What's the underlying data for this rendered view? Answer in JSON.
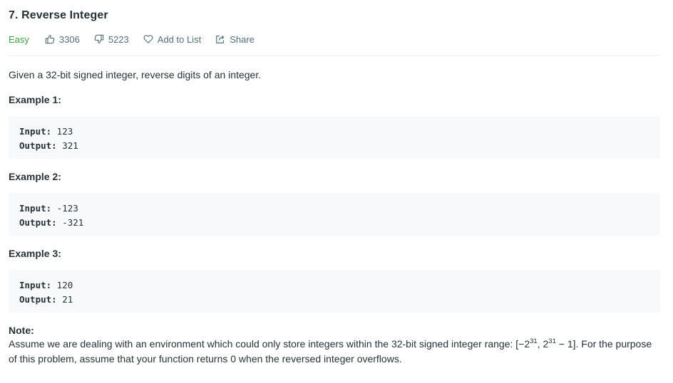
{
  "problem": {
    "title": "7. Reverse Integer",
    "difficulty": "Easy",
    "likes": "3306",
    "dislikes": "5223",
    "add_to_list_label": "Add to List",
    "share_label": "Share"
  },
  "colors": {
    "difficulty_easy": "#43a047",
    "code_bg": "#f7f9fa",
    "divider": "#eceff1"
  },
  "description": {
    "intro": "Given a 32-bit signed integer, reverse digits of an integer."
  },
  "examples": [
    {
      "heading": "Example 1:",
      "input_label": "Input:",
      "input": " 123",
      "output_label": "Output:",
      "output": " 321"
    },
    {
      "heading": "Example 2:",
      "input_label": "Input:",
      "input": " -123",
      "output_label": "Output:",
      "output": " -321"
    },
    {
      "heading": "Example 3:",
      "input_label": "Input:",
      "input": " 120",
      "output_label": "Output:",
      "output": " 21"
    }
  ],
  "note": {
    "heading": "Note:",
    "text_before": "Assume we are dealing with an environment which could only store integers within the 32-bit signed integer range: [−2",
    "exp1": "31",
    "mid": ",  2",
    "exp2": "31",
    "text_after": " − 1]. For the purpose of this problem, assume that your function returns 0 when the reversed integer overflows."
  },
  "icons": {
    "like": "thumbs-up-icon",
    "dislike": "thumbs-down-icon",
    "add_to_list": "heart-icon",
    "share": "share-icon"
  }
}
